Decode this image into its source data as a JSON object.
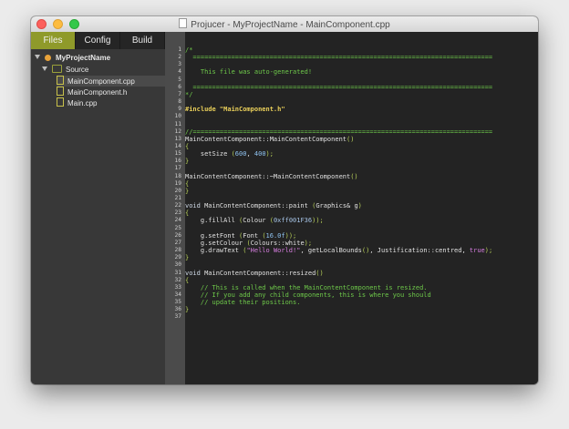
{
  "window": {
    "title": "Projucer - MyProjectName - MainComponent.cpp"
  },
  "sidebar": {
    "tabs": [
      {
        "label": "Files",
        "active": true
      },
      {
        "label": "Config",
        "active": false
      },
      {
        "label": "Build",
        "active": false
      }
    ],
    "tree": {
      "project": "MyProjectName",
      "group": "Source",
      "files": [
        "MainComponent.cpp",
        "MainComponent.h",
        "Main.cpp"
      ],
      "selected_file": "MainComponent.cpp"
    }
  },
  "editor": {
    "line_numbers": [
      "1",
      "2",
      "3",
      "4",
      "5",
      "6",
      "7",
      "8",
      "9",
      "10",
      "11",
      "12",
      "13",
      "14",
      "15",
      "16",
      "17",
      "18",
      "19",
      "20",
      "21",
      "22",
      "23",
      "24",
      "25",
      "26",
      "27",
      "28",
      "29",
      "30",
      "31",
      "32",
      "33",
      "34",
      "35",
      "36",
      "37"
    ],
    "lines": [
      [
        {
          "t": "/*",
          "c": "cm"
        }
      ],
      [
        {
          "t": "  ==============================================================================",
          "c": "cm"
        }
      ],
      [],
      [
        {
          "t": "    This file was auto-generated!",
          "c": "cm"
        }
      ],
      [],
      [
        {
          "t": "  ==============================================================================",
          "c": "cm"
        }
      ],
      [
        {
          "t": "*/",
          "c": "cm"
        }
      ],
      [],
      [
        {
          "t": "#include \"MainComponent.h\"",
          "c": "pp"
        }
      ],
      [],
      [],
      [
        {
          "t": "//==============================================================================",
          "c": "cm"
        }
      ],
      [
        {
          "t": "MainContentComponent::MainContentComponent",
          "c": ""
        },
        {
          "t": "()",
          "c": "pn"
        }
      ],
      [
        {
          "t": "{",
          "c": "pn"
        }
      ],
      [
        {
          "t": "    setSize ",
          "c": ""
        },
        {
          "t": "(",
          "c": "pn"
        },
        {
          "t": "600",
          "c": "num"
        },
        {
          "t": ", ",
          "c": ""
        },
        {
          "t": "400",
          "c": "num"
        },
        {
          "t": ");",
          "c": "pn"
        }
      ],
      [
        {
          "t": "}",
          "c": "pn"
        }
      ],
      [],
      [
        {
          "t": "MainContentComponent::~MainContentComponent",
          "c": ""
        },
        {
          "t": "()",
          "c": "pn"
        }
      ],
      [
        {
          "t": "{",
          "c": "pn"
        }
      ],
      [
        {
          "t": "}",
          "c": "pn"
        }
      ],
      [],
      [
        {
          "t": "void ",
          "c": "kw"
        },
        {
          "t": "MainContentComponent::paint ",
          "c": ""
        },
        {
          "t": "(",
          "c": "pn"
        },
        {
          "t": "Graphics& g",
          "c": ""
        },
        {
          "t": ")",
          "c": "pn"
        }
      ],
      [
        {
          "t": "{",
          "c": "pn"
        }
      ],
      [
        {
          "t": "    g.fillAll ",
          "c": ""
        },
        {
          "t": "(",
          "c": "pn"
        },
        {
          "t": "Colour ",
          "c": ""
        },
        {
          "t": "(",
          "c": "pn"
        },
        {
          "t": "0xff001F36",
          "c": "hex"
        },
        {
          "t": "));",
          "c": "pn"
        }
      ],
      [],
      [
        {
          "t": "    g.setFont ",
          "c": ""
        },
        {
          "t": "(",
          "c": "pn"
        },
        {
          "t": "Font ",
          "c": ""
        },
        {
          "t": "(",
          "c": "pn"
        },
        {
          "t": "16.0f",
          "c": "num"
        },
        {
          "t": "));",
          "c": "pn"
        }
      ],
      [
        {
          "t": "    g.setColour ",
          "c": ""
        },
        {
          "t": "(",
          "c": "pn"
        },
        {
          "t": "Colours::white",
          "c": ""
        },
        {
          "t": ");",
          "c": "pn"
        }
      ],
      [
        {
          "t": "    g.drawText ",
          "c": ""
        },
        {
          "t": "(",
          "c": "pn"
        },
        {
          "t": "\"Hello World!\"",
          "c": "str"
        },
        {
          "t": ", getLocalBounds",
          "c": ""
        },
        {
          "t": "()",
          "c": "pn"
        },
        {
          "t": ", Justification::centred, ",
          "c": ""
        },
        {
          "t": "true",
          "c": "str"
        },
        {
          "t": ");",
          "c": "pn"
        }
      ],
      [
        {
          "t": "}",
          "c": "pn"
        }
      ],
      [],
      [
        {
          "t": "void ",
          "c": "kw"
        },
        {
          "t": "MainContentComponent::resized",
          "c": ""
        },
        {
          "t": "()",
          "c": "pn"
        }
      ],
      [
        {
          "t": "{",
          "c": "pn"
        }
      ],
      [
        {
          "t": "    // This is called when the MainContentComponent is resized.",
          "c": "cm"
        }
      ],
      [
        {
          "t": "    // If you add any child components, this is where you should",
          "c": "cm"
        }
      ],
      [
        {
          "t": "    // update their positions.",
          "c": "cm"
        }
      ],
      [
        {
          "t": "}",
          "c": "pn"
        }
      ],
      []
    ]
  }
}
